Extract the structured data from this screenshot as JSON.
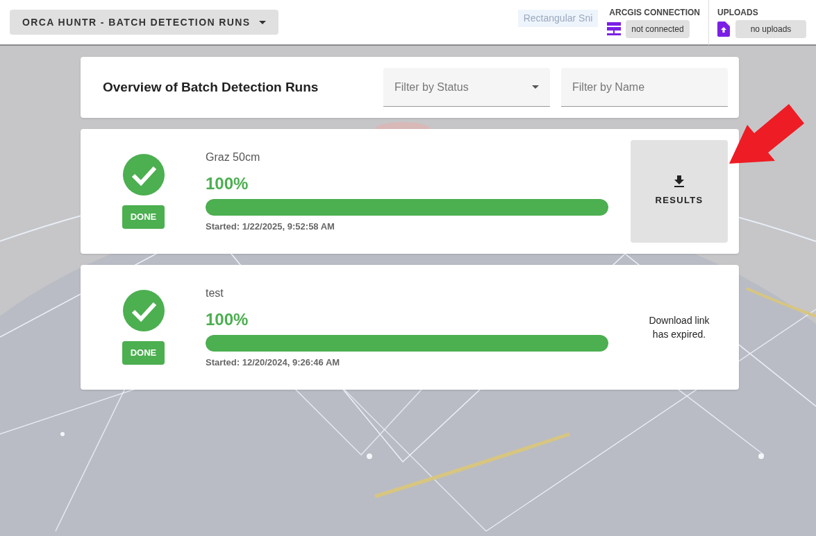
{
  "app_menu": {
    "label": "ORCA HUNTR - BATCH DETECTION RUNS"
  },
  "snip_hint": "Rectangular Sni",
  "arcgis": {
    "title": "ARCGIS CONNECTION",
    "status": "not connected"
  },
  "uploads": {
    "title": "UPLOADS",
    "status": "no uploads"
  },
  "overview": {
    "title": "Overview of Batch Detection Runs",
    "status_filter": {
      "placeholder": "Filter by Status"
    },
    "name_filter": {
      "placeholder": "Filter by Name"
    }
  },
  "runs": [
    {
      "name": "Graz 50cm",
      "percent": "100%",
      "level": 1,
      "status": "DONE",
      "started": "Started: 1/22/2025, 9:52:58 AM",
      "action": {
        "kind": "button",
        "label": "RESULTS"
      }
    },
    {
      "name": "test",
      "percent": "100%",
      "level": 1,
      "status": "DONE",
      "started": "Started: 12/20/2024, 9:26:46 AM",
      "action": {
        "kind": "note",
        "label": "Download link has expired."
      }
    }
  ]
}
